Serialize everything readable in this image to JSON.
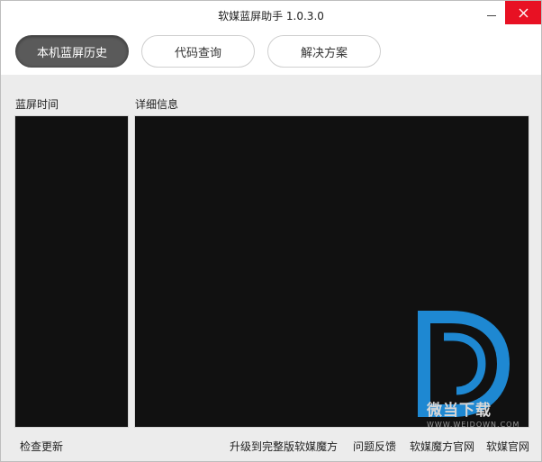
{
  "window": {
    "title": "软媒蓝屏助手 1.0.3.0"
  },
  "tabs": [
    {
      "label": "本机蓝屏历史",
      "active": true
    },
    {
      "label": "代码查询",
      "active": false
    },
    {
      "label": "解决方案",
      "active": false
    }
  ],
  "panels": {
    "left_label": "蓝屏时间",
    "right_label": "详细信息"
  },
  "watermark": {
    "text": "微当下载",
    "sub": "WWW.WEIDOWN.COM"
  },
  "footer": {
    "check_update": "检查更新",
    "upgrade": "升级到完整版软媒魔方",
    "feedback": "问题反馈",
    "mofang_site": "软媒魔方官网",
    "ruanmei_site": "软媒官网"
  },
  "colors": {
    "close": "#e81123",
    "active_tab": "#5a5a5a",
    "panel_bg": "#0a0a0a",
    "watermark_blue": "#1e88d2"
  }
}
